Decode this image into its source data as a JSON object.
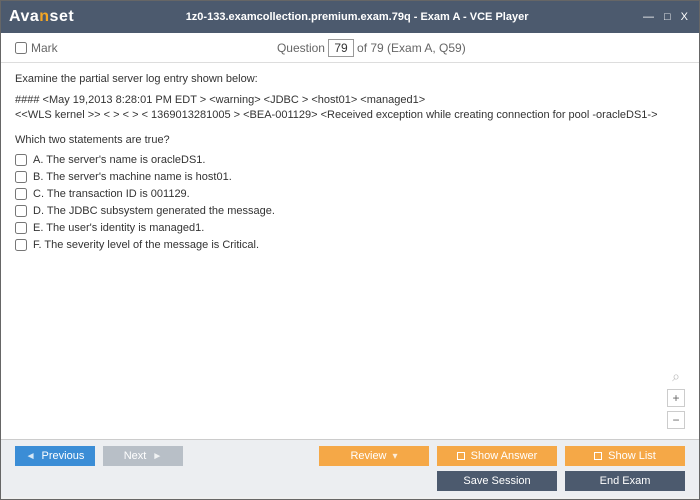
{
  "titlebar": {
    "logo_pre": "Ava",
    "logo_orange": "n",
    "logo_post": "set",
    "title": "1z0-133.examcollection.premium.exam.79q - Exam A - VCE Player"
  },
  "subheader": {
    "mark_label": "Mark",
    "question_word": "Question",
    "current_num": "79",
    "total_text": " of 79 (Exam A, Q59)"
  },
  "question": {
    "intro": "Examine the partial server log entry shown below:",
    "log1": "#### <May 19,2013 8:28:01 PM EDT > <warning> <JDBC > <host01> <managed1>",
    "log2": "<<WLS kernel >> < > < > < 1369013281005 > <BEA-001129> <Received exception while creating connection for pool -oracleDS1->",
    "prompt": "Which two statements are true?",
    "options": [
      "A.  The server's name is oracleDS1.",
      "B.  The server's machine name is host01.",
      "C.  The transaction ID is 001129.",
      "D.  The JDBC subsystem generated the message.",
      "E.  The user's identity is managed1.",
      "F.  The severity level of the message is Critical."
    ]
  },
  "footer": {
    "previous": "Previous",
    "next": "Next",
    "review": "Review",
    "show_answer": "Show Answer",
    "show_list": "Show List",
    "save_session": "Save Session",
    "end_exam": "End Exam"
  }
}
